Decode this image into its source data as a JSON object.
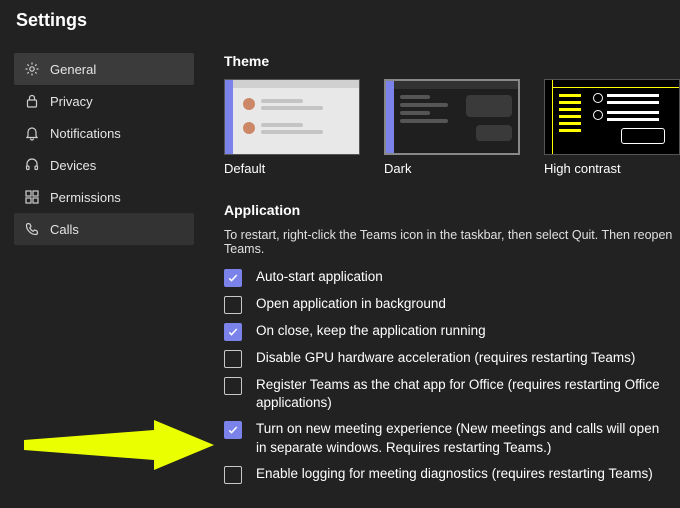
{
  "title": "Settings",
  "sidebar": {
    "items": [
      {
        "label": "General"
      },
      {
        "label": "Privacy"
      },
      {
        "label": "Notifications"
      },
      {
        "label": "Devices"
      },
      {
        "label": "Permissions"
      },
      {
        "label": "Calls"
      }
    ]
  },
  "theme": {
    "heading": "Theme",
    "options": [
      {
        "label": "Default"
      },
      {
        "label": "Dark"
      },
      {
        "label": "High contrast"
      }
    ],
    "selected": 1
  },
  "application": {
    "heading": "Application",
    "help": "To restart, right-click the Teams icon in the taskbar, then select Quit. Then reopen Teams.",
    "options": [
      {
        "label": "Auto-start application",
        "checked": true
      },
      {
        "label": "Open application in background",
        "checked": false
      },
      {
        "label": "On close, keep the application running",
        "checked": true
      },
      {
        "label": "Disable GPU hardware acceleration (requires restarting Teams)",
        "checked": false
      },
      {
        "label": "Register Teams as the chat app for Office (requires restarting Office applications)",
        "checked": false
      },
      {
        "label": "Turn on new meeting experience (New meetings and calls will open in separate windows. Requires restarting Teams.)",
        "checked": true
      },
      {
        "label": "Enable logging for meeting diagnostics (requires restarting Teams)",
        "checked": false
      }
    ]
  }
}
